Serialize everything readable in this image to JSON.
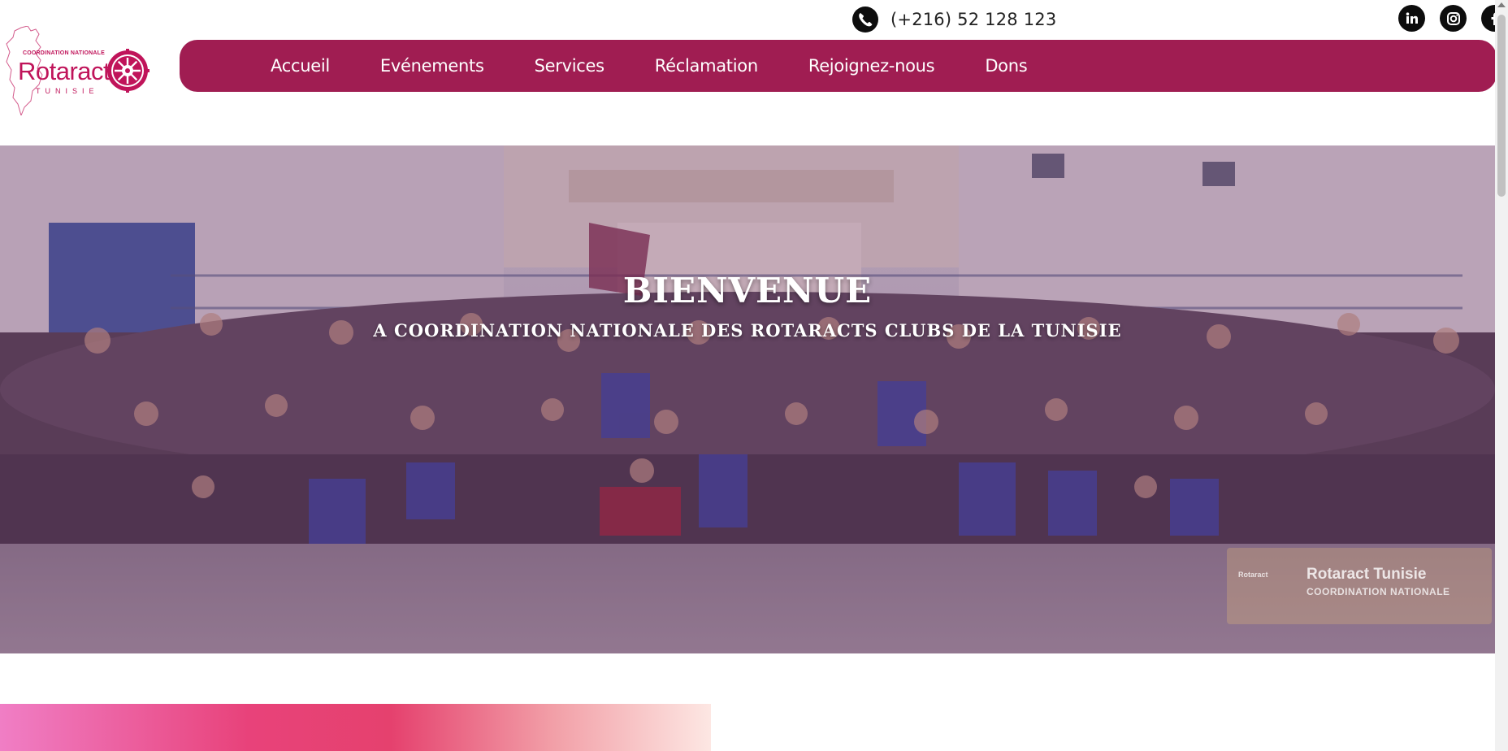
{
  "logo": {
    "coordination": "COORDINATION NATIONALE",
    "brand": "Rotaract",
    "country": "TUNISIE"
  },
  "contact": {
    "icon": "whatsapp-icon",
    "phone": "(+216) 52 128 123"
  },
  "socials": [
    {
      "name": "linkedin",
      "icon": "linkedin-icon",
      "label": "in"
    },
    {
      "name": "instagram",
      "icon": "instagram-icon"
    },
    {
      "name": "facebook",
      "icon": "facebook-icon",
      "label": "f"
    }
  ],
  "nav": {
    "items": [
      {
        "label": "Accueil"
      },
      {
        "label": "Evénements"
      },
      {
        "label": "Services"
      },
      {
        "label": "Réclamation"
      },
      {
        "label": "Rejoignez-nous"
      },
      {
        "label": "Dons"
      }
    ]
  },
  "hero": {
    "title": "BIENVENUE",
    "subtitle": "A COORDINATION NATIONALE DES ROTARACTS CLUBS DE LA TUNISIE",
    "watermark": {
      "small": "Rotaract",
      "title": "Rotaract Tunisie",
      "subtitle": "COORDINATION NATIONALE"
    }
  },
  "colors": {
    "brand": "#a01d52",
    "logo": "#c0145a",
    "text": "#222222"
  }
}
